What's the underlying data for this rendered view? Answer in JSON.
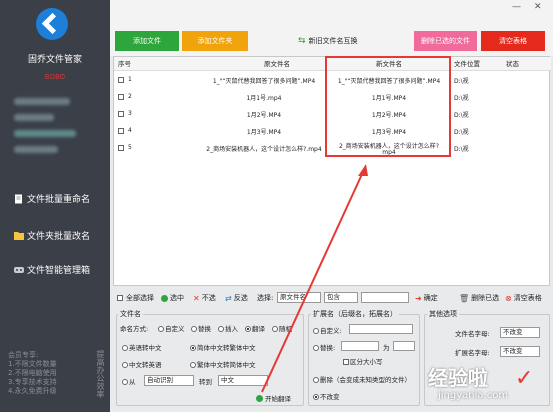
{
  "sidebar": {
    "app_name": "固乔文件管家",
    "user_name": "BOBO",
    "nav": [
      {
        "label": "文件批量重命名",
        "icon": "document-icon"
      },
      {
        "label": "文件夹批量改名",
        "icon": "folder-icon"
      },
      {
        "label": "文件智能管理箱",
        "icon": "gamepad-icon"
      }
    ],
    "notice_title": "会员专享:",
    "notice_lines": [
      "1.不限文件数量",
      "2.不限电脑使用",
      "3.专享技术支持",
      "4.永久免费升级"
    ],
    "vertical_text": "提高办公效率"
  },
  "window": {
    "minimize": "—",
    "close": "✕"
  },
  "toolbar": {
    "add_file": "添加文件",
    "add_folder": "添加文件夹",
    "swap_names": "新旧文件名互换",
    "delete_selected": "删除已选的文件",
    "clear_table": "清空表格"
  },
  "table": {
    "headers": [
      "序号",
      "原文件名",
      "新文件名",
      "文件位置",
      "状态"
    ],
    "rows": [
      {
        "idx": "1",
        "orig": "1_\"“灭鼠代替我回答了很多问题”.MP4",
        "new": "1_\"“灭鼠代替我回答了很多问题”.MP4",
        "loc": "D:\\视"
      },
      {
        "idx": "2",
        "orig": "1月1号.mp4",
        "new": "1月1号.MP4",
        "loc": "D:\\视"
      },
      {
        "idx": "3",
        "orig": "1月2号.MP4",
        "new": "1月2号.MP4",
        "loc": "D:\\视"
      },
      {
        "idx": "4",
        "orig": "1月3号.MP4",
        "new": "1月3号.MP4",
        "loc": "D:\\视"
      },
      {
        "idx": "5",
        "orig": "2_商场安装机器人，这个设计怎么样?.mp4",
        "new_line1": "2_商场安装机器人，这个设计怎么样?",
        "new_line2": "mp4",
        "loc": "D:\\视"
      }
    ]
  },
  "filter": {
    "select_all": "全部选择",
    "select": "选中",
    "deselect": "不选",
    "invert": "反选",
    "choose_label": "选择:",
    "field": "原文件名",
    "op": "包含",
    "value": "",
    "confirm": "确定",
    "delete_selected": "删除已选",
    "clear_table": "清空表格"
  },
  "filename_group": {
    "title": "文件名",
    "mode_label": "命名方式:",
    "modes": [
      "自定义",
      "替换",
      "插入",
      "翻译",
      "随机"
    ],
    "options": [
      [
        "英语转中文",
        "简体中文转繁体中文"
      ],
      [
        "中文转英语",
        "繁体中文转简体中文"
      ]
    ],
    "from_label": "从",
    "from_value": "自动识别",
    "to_label": "转到",
    "to_value": "中文",
    "start_button": "开始翻译"
  },
  "ext_group": {
    "title": "扩展名（后缀名，拓展名）",
    "custom": "自定义:",
    "replace": "替换:",
    "replace_to": "为",
    "case_sensitive": "区分大小写",
    "delete": "删除（会变成未知类型的文件）",
    "unchanged": "不改变"
  },
  "other_group": {
    "title": "其他选项",
    "filename_case_label": "文件名字母:",
    "filename_case_value": "不改变",
    "ext_case_label": "扩展名字母:",
    "ext_case_value": "不改变"
  },
  "watermark": {
    "text": "经验啦",
    "sub": "jingyanla.com"
  },
  "colors": {
    "add_file": "#2da63b",
    "add_folder": "#f0a30a",
    "delete_selected": "#f06a9b",
    "clear_table": "#e52a1d",
    "sidebar": "#3b3f47",
    "highlight": "#e53935"
  }
}
